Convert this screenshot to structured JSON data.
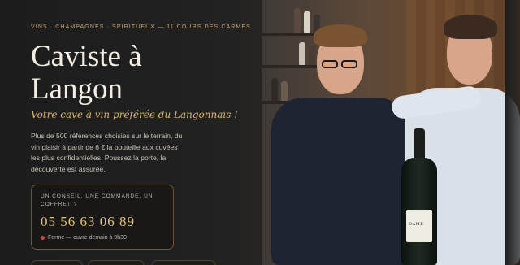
{
  "hero": {
    "eyebrow": "VINS · CHAMPAGNES · SPIRITUEUX — 11 COURS DES CARMES",
    "title": "Caviste à Langon",
    "tagline": "Votre cave à vin préférée du Langonnais !",
    "description": "Plus de 500 références choisies sur le terrain, du vin plaisir à partir de 6 € la bouteille aux cuvées les plus confidentielles. Poussez la porte, la découverte est assurée."
  },
  "contact_card": {
    "label": "UN CONSEIL, UNE COMMANDE, UN COFFRET ?",
    "phone": "05 56 63 06 89",
    "status": "Fermé — ouvre demain à 9h30",
    "status_color": "#d0463b"
  },
  "photo": {
    "bottle_label": "DAME"
  },
  "colors": {
    "accent": "#c9a46a",
    "phone": "#e7c27a",
    "background": "#1c1c1c"
  }
}
